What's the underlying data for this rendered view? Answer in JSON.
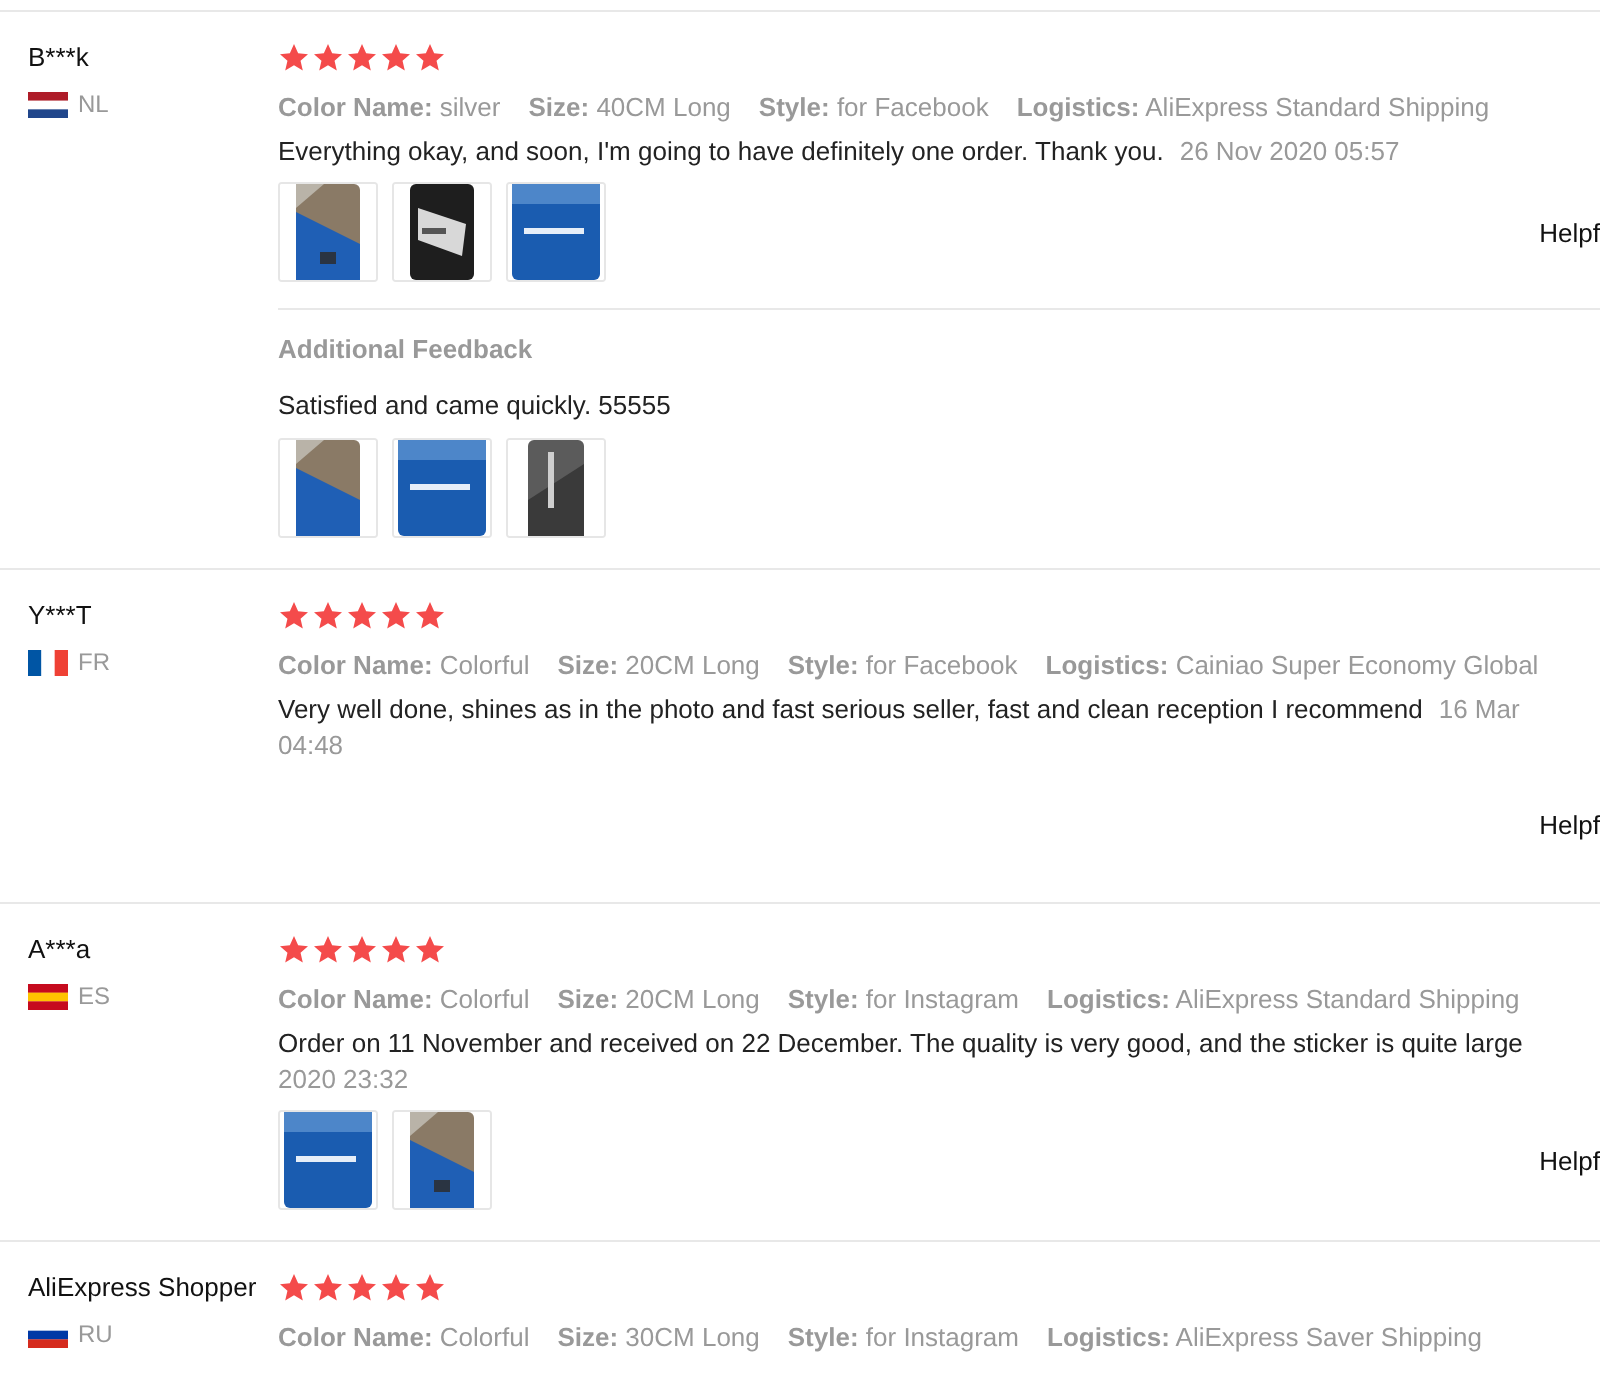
{
  "reviews": [
    {
      "user": "B***k",
      "country": "NL",
      "stars": 5,
      "attributes": [
        {
          "label": "Color Name:",
          "value": "silver"
        },
        {
          "label": "Size:",
          "value": "40CM Long"
        },
        {
          "label": "Style:",
          "value": "for Facebook"
        },
        {
          "label": "Logistics:",
          "value": "AliExpress Standard Shipping"
        }
      ],
      "comment": "Everything okay, and soon, I'm going to have definitely one order. Thank you.",
      "date": "26 Nov 2020 05:57",
      "photos": [
        {
          "kind": "picture"
        },
        {
          "kind": "picture"
        },
        {
          "kind": "picture"
        }
      ],
      "helpful": "Helpf",
      "additional": {
        "title": "Additional Feedback",
        "comment": "Satisfied and came quickly. 55555",
        "photos": [
          {
            "kind": "picture"
          },
          {
            "kind": "picture"
          },
          {
            "kind": "picture"
          }
        ]
      }
    },
    {
      "user": "Y***T",
      "country": "FR",
      "stars": 5,
      "attributes": [
        {
          "label": "Color Name:",
          "value": "Colorful"
        },
        {
          "label": "Size:",
          "value": "20CM Long"
        },
        {
          "label": "Style:",
          "value": "for Facebook"
        },
        {
          "label": "Logistics:",
          "value": "Cainiao Super Economy Global"
        }
      ],
      "comment": "Very well done, shines as in the photo and fast serious seller, fast and clean reception I recommend",
      "date": "16 Mar",
      "date_continued": "04:48",
      "helpful": "Helpf"
    },
    {
      "user": "A***a",
      "country": "ES",
      "stars": 5,
      "attributes": [
        {
          "label": "Color Name:",
          "value": "Colorful"
        },
        {
          "label": "Size:",
          "value": "20CM Long"
        },
        {
          "label": "Style:",
          "value": "for Instagram"
        },
        {
          "label": "Logistics:",
          "value": "AliExpress Standard Shipping"
        }
      ],
      "comment": "Order on 11 November and received on 22 December. The quality is very good, and the sticker is quite large",
      "date_continued": "2020 23:32",
      "photos": [
        {
          "kind": "picture"
        },
        {
          "kind": "picture"
        }
      ],
      "helpful": "Helpf"
    },
    {
      "user": "AliExpress Shopper",
      "country": "RU",
      "stars": 5,
      "attributes": [
        {
          "label": "Color Name:",
          "value": "Colorful"
        },
        {
          "label": "Size:",
          "value": "30CM Long"
        },
        {
          "label": "Style:",
          "value": "for Instagram"
        },
        {
          "label": "Logistics:",
          "value": "AliExpress Saver Shipping"
        }
      ]
    }
  ]
}
